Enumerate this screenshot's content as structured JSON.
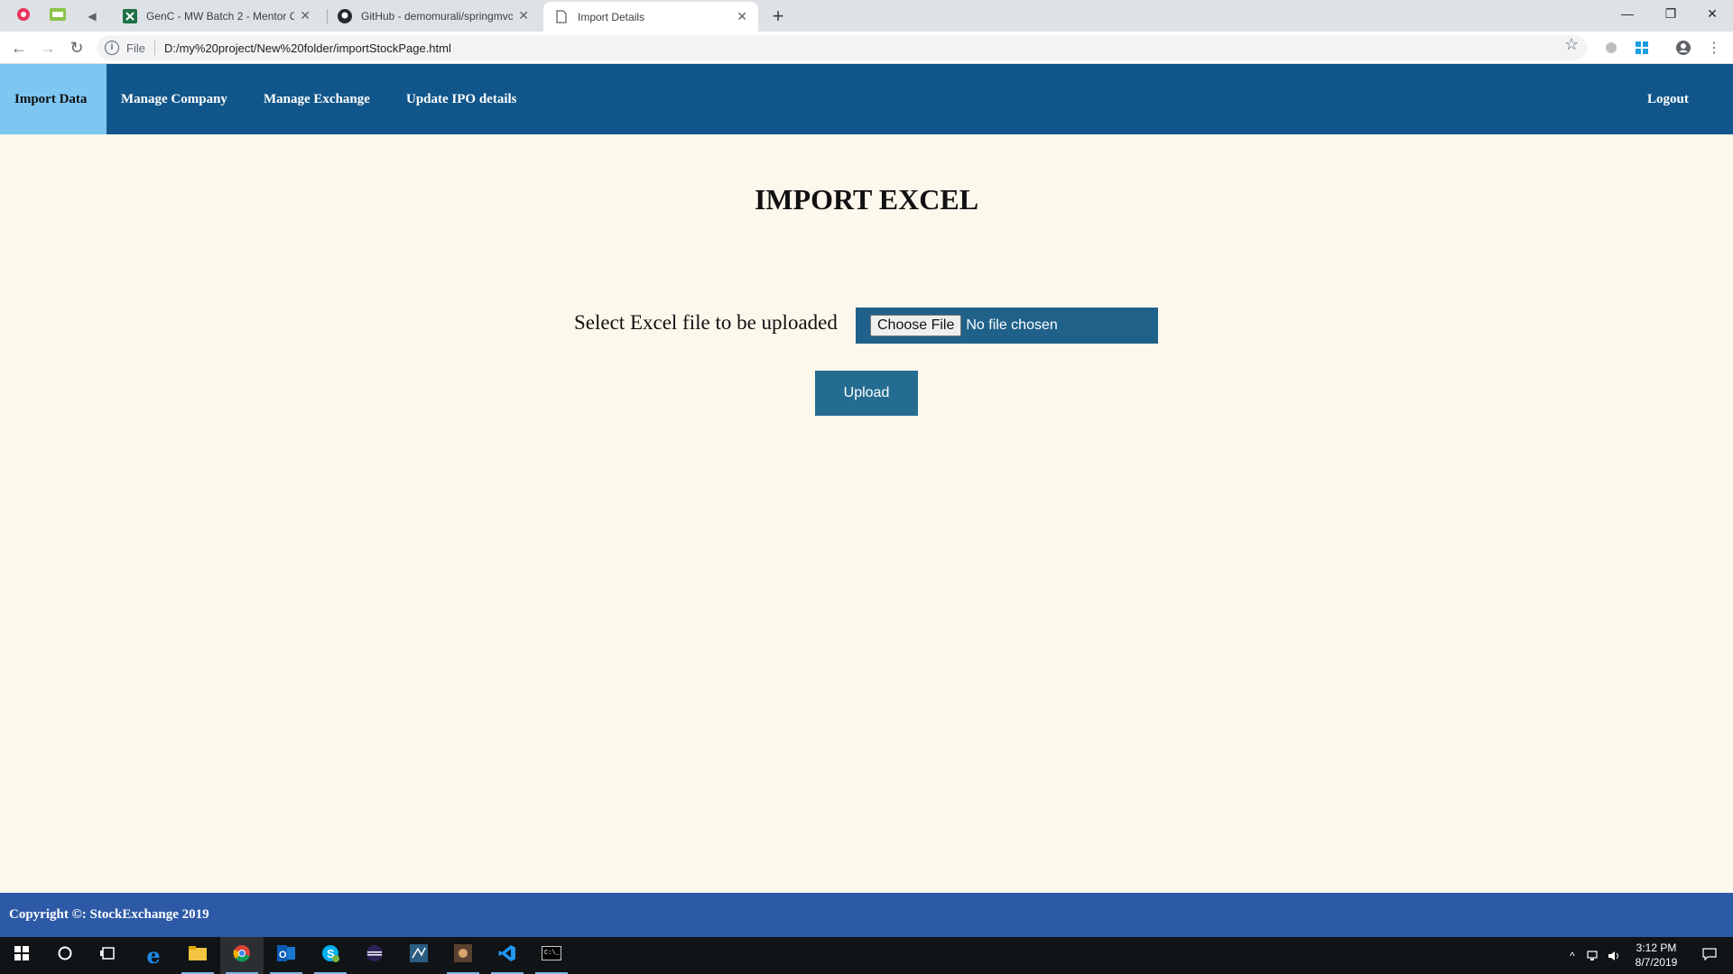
{
  "browser": {
    "tabs": [
      {
        "title": "GenC - MW Batch 2 - Mentor Co"
      },
      {
        "title": "GitHub - demomurali/springmvc"
      },
      {
        "title": "Import Details"
      }
    ],
    "url_scheme": "File",
    "url": "D:/my%20project/New%20folder/importStockPage.html"
  },
  "nav": {
    "items": [
      "Import Data",
      "Manage Company",
      "Manage Exchange",
      "Update IPO details"
    ],
    "logout": "Logout",
    "active_index": 0
  },
  "main": {
    "heading": "IMPORT EXCEL",
    "file_label": "Select Excel file to be uploaded",
    "choose_button": "Choose File",
    "no_file_text": "No file chosen",
    "upload_button": "Upload"
  },
  "footer": {
    "text": "Copyright ©: StockExchange 2019"
  },
  "taskbar": {
    "time": "3:12 PM",
    "date": "8/7/2019"
  },
  "colors": {
    "nav_bg": "#11568a",
    "nav_active": "#7ec6f2",
    "page_bg": "#fdf8ec",
    "file_box": "#20618a",
    "upload_btn": "#256c91",
    "footer_bg": "#2d5aa6"
  }
}
